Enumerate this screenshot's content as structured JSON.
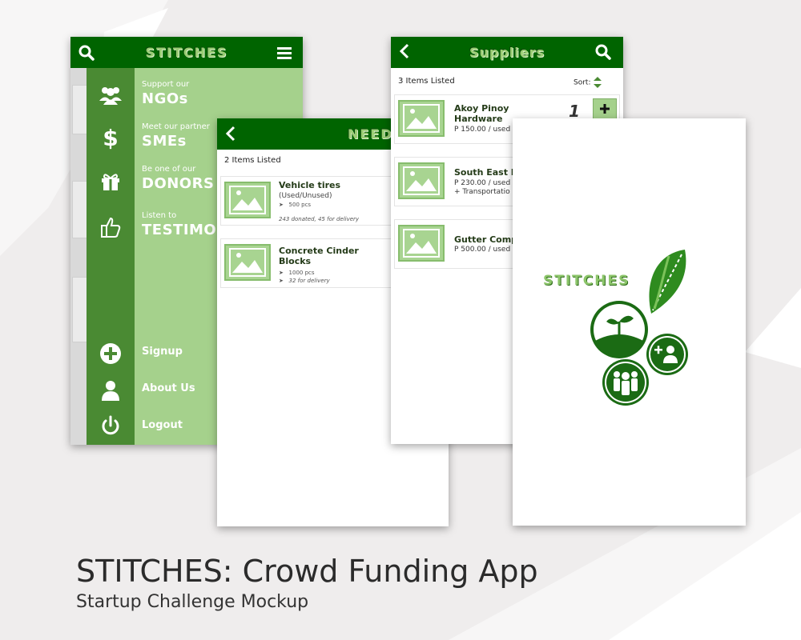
{
  "caption": {
    "title": "STITCHES: Crowd Funding App",
    "subtitle": "Startup Challenge Mockup"
  },
  "menu_screen": {
    "brand": "STITCHES",
    "items": [
      {
        "small": "Support our",
        "big": "NGOs",
        "icon": "people-group-icon"
      },
      {
        "small": "Meet our partner",
        "big": "SMEs",
        "icon": "dollar-icon"
      },
      {
        "small": "Be one of our",
        "big": "DONORS",
        "icon": "gift-icon"
      },
      {
        "small": "Listen to",
        "big": "TESTIMON",
        "icon": "thumbs-up-icon"
      }
    ],
    "bottom_items": [
      {
        "label": "Signup",
        "icon": "plus-circle-icon"
      },
      {
        "label": "About Us",
        "icon": "user-icon"
      },
      {
        "label": "Logout",
        "icon": "power-icon"
      }
    ]
  },
  "needs_screen": {
    "title": "NEEDS",
    "count_label": "2 Items Listed",
    "items": [
      {
        "title": "Vehicle tires",
        "sub": "(Used/Unused)",
        "qty": "500 pcs",
        "note": "243 donated,  45 for delivery"
      },
      {
        "title_line1": "Concrete Cinder",
        "title_line2": "Blocks",
        "qty": "1000 pcs",
        "note": "32 for delivery"
      }
    ]
  },
  "suppliers_screen": {
    "title": "Suppliers",
    "count_label": "3 Items Listed",
    "sort_label": "Sort:",
    "items": [
      {
        "title_line1": "Akoy Pinoy",
        "title_line2": "Hardware",
        "price": "P 150.00 / used",
        "qty": "1"
      },
      {
        "title_line1": "South East Er",
        "price": "P 230.00 / used",
        "extra": "+ Transportatio"
      },
      {
        "title_line1": "Gutter Comp",
        "price": "P 500.00 / used"
      }
    ]
  },
  "splash_screen": {
    "brand": "STITCHES"
  },
  "colors": {
    "dark_green": "#006400",
    "rail_green": "#4a8a33",
    "light_green": "#a5d18c"
  }
}
